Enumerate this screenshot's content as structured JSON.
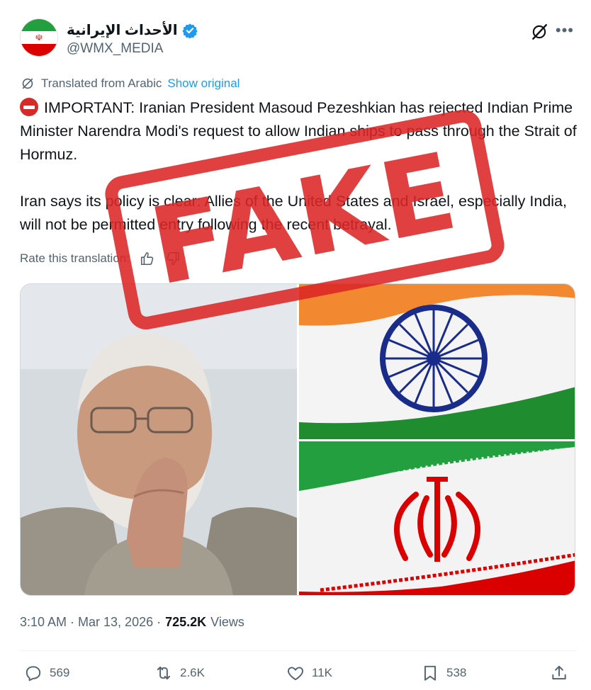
{
  "author": {
    "display_name": "الأحداث الإيرانية",
    "handle": "@WMX_MEDIA",
    "avatar_emblem": "☫"
  },
  "translation": {
    "label": "Translated from Arabic",
    "show_original": "Show original",
    "rate_label": "Rate this translation:"
  },
  "tweet": {
    "paragraph1": "IMPORTANT: Iranian President Masoud Pezeshkian has rejected Indian Prime Minister Narendra Modi's request to allow Indian ships to pass through the Strait of Hormuz.",
    "paragraph2": "Iran says its policy is clear: Allies of the United States and Israel, especially India, will not be permitted entry following the recent betrayal."
  },
  "stamp": {
    "text": "FAKE"
  },
  "meta": {
    "time": "3:10 AM · Mar 13, 2026 ·",
    "views_count": "725.2K",
    "views_label": "Views"
  },
  "actions": {
    "replies": "569",
    "reposts": "2.6K",
    "likes": "11K",
    "bookmarks": "538"
  },
  "colors": {
    "accent": "#1d9bf0",
    "stamp_red": "#dc2626",
    "secondary_text": "#536471"
  },
  "icons": [
    "verified-badge-icon",
    "grok-icon",
    "more-icon",
    "translate-icon",
    "no-entry-icon",
    "thumbs-up-icon",
    "thumbs-down-icon",
    "reply-icon",
    "repost-icon",
    "like-icon",
    "bookmark-icon",
    "share-icon"
  ]
}
